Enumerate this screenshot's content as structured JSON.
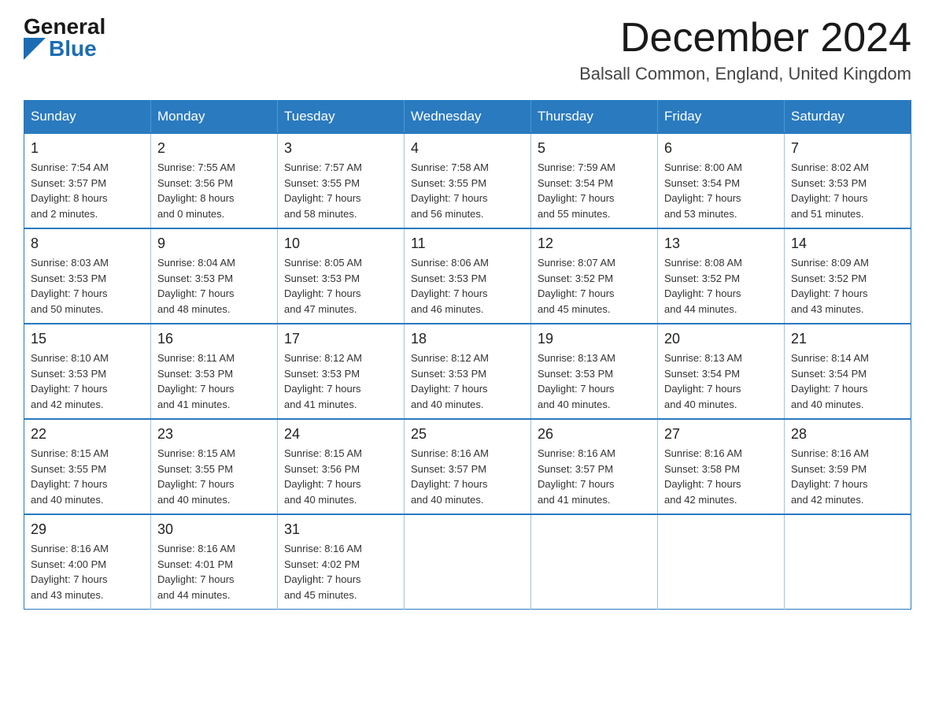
{
  "header": {
    "logo_general": "General",
    "logo_blue": "Blue",
    "month": "December 2024",
    "location": "Balsall Common, England, United Kingdom"
  },
  "days_of_week": [
    "Sunday",
    "Monday",
    "Tuesday",
    "Wednesday",
    "Thursday",
    "Friday",
    "Saturday"
  ],
  "weeks": [
    [
      {
        "day": "1",
        "sunrise": "7:54 AM",
        "sunset": "3:57 PM",
        "daylight": "8 hours and 2 minutes."
      },
      {
        "day": "2",
        "sunrise": "7:55 AM",
        "sunset": "3:56 PM",
        "daylight": "8 hours and 0 minutes."
      },
      {
        "day": "3",
        "sunrise": "7:57 AM",
        "sunset": "3:55 PM",
        "daylight": "7 hours and 58 minutes."
      },
      {
        "day": "4",
        "sunrise": "7:58 AM",
        "sunset": "3:55 PM",
        "daylight": "7 hours and 56 minutes."
      },
      {
        "day": "5",
        "sunrise": "7:59 AM",
        "sunset": "3:54 PM",
        "daylight": "7 hours and 55 minutes."
      },
      {
        "day": "6",
        "sunrise": "8:00 AM",
        "sunset": "3:54 PM",
        "daylight": "7 hours and 53 minutes."
      },
      {
        "day": "7",
        "sunrise": "8:02 AM",
        "sunset": "3:53 PM",
        "daylight": "7 hours and 51 minutes."
      }
    ],
    [
      {
        "day": "8",
        "sunrise": "8:03 AM",
        "sunset": "3:53 PM",
        "daylight": "7 hours and 50 minutes."
      },
      {
        "day": "9",
        "sunrise": "8:04 AM",
        "sunset": "3:53 PM",
        "daylight": "7 hours and 48 minutes."
      },
      {
        "day": "10",
        "sunrise": "8:05 AM",
        "sunset": "3:53 PM",
        "daylight": "7 hours and 47 minutes."
      },
      {
        "day": "11",
        "sunrise": "8:06 AM",
        "sunset": "3:53 PM",
        "daylight": "7 hours and 46 minutes."
      },
      {
        "day": "12",
        "sunrise": "8:07 AM",
        "sunset": "3:52 PM",
        "daylight": "7 hours and 45 minutes."
      },
      {
        "day": "13",
        "sunrise": "8:08 AM",
        "sunset": "3:52 PM",
        "daylight": "7 hours and 44 minutes."
      },
      {
        "day": "14",
        "sunrise": "8:09 AM",
        "sunset": "3:52 PM",
        "daylight": "7 hours and 43 minutes."
      }
    ],
    [
      {
        "day": "15",
        "sunrise": "8:10 AM",
        "sunset": "3:53 PM",
        "daylight": "7 hours and 42 minutes."
      },
      {
        "day": "16",
        "sunrise": "8:11 AM",
        "sunset": "3:53 PM",
        "daylight": "7 hours and 41 minutes."
      },
      {
        "day": "17",
        "sunrise": "8:12 AM",
        "sunset": "3:53 PM",
        "daylight": "7 hours and 41 minutes."
      },
      {
        "day": "18",
        "sunrise": "8:12 AM",
        "sunset": "3:53 PM",
        "daylight": "7 hours and 40 minutes."
      },
      {
        "day": "19",
        "sunrise": "8:13 AM",
        "sunset": "3:53 PM",
        "daylight": "7 hours and 40 minutes."
      },
      {
        "day": "20",
        "sunrise": "8:13 AM",
        "sunset": "3:54 PM",
        "daylight": "7 hours and 40 minutes."
      },
      {
        "day": "21",
        "sunrise": "8:14 AM",
        "sunset": "3:54 PM",
        "daylight": "7 hours and 40 minutes."
      }
    ],
    [
      {
        "day": "22",
        "sunrise": "8:15 AM",
        "sunset": "3:55 PM",
        "daylight": "7 hours and 40 minutes."
      },
      {
        "day": "23",
        "sunrise": "8:15 AM",
        "sunset": "3:55 PM",
        "daylight": "7 hours and 40 minutes."
      },
      {
        "day": "24",
        "sunrise": "8:15 AM",
        "sunset": "3:56 PM",
        "daylight": "7 hours and 40 minutes."
      },
      {
        "day": "25",
        "sunrise": "8:16 AM",
        "sunset": "3:57 PM",
        "daylight": "7 hours and 40 minutes."
      },
      {
        "day": "26",
        "sunrise": "8:16 AM",
        "sunset": "3:57 PM",
        "daylight": "7 hours and 41 minutes."
      },
      {
        "day": "27",
        "sunrise": "8:16 AM",
        "sunset": "3:58 PM",
        "daylight": "7 hours and 42 minutes."
      },
      {
        "day": "28",
        "sunrise": "8:16 AM",
        "sunset": "3:59 PM",
        "daylight": "7 hours and 42 minutes."
      }
    ],
    [
      {
        "day": "29",
        "sunrise": "8:16 AM",
        "sunset": "4:00 PM",
        "daylight": "7 hours and 43 minutes."
      },
      {
        "day": "30",
        "sunrise": "8:16 AM",
        "sunset": "4:01 PM",
        "daylight": "7 hours and 44 minutes."
      },
      {
        "day": "31",
        "sunrise": "8:16 AM",
        "sunset": "4:02 PM",
        "daylight": "7 hours and 45 minutes."
      },
      null,
      null,
      null,
      null
    ]
  ],
  "labels": {
    "sunrise": "Sunrise:",
    "sunset": "Sunset:",
    "daylight": "Daylight:"
  }
}
